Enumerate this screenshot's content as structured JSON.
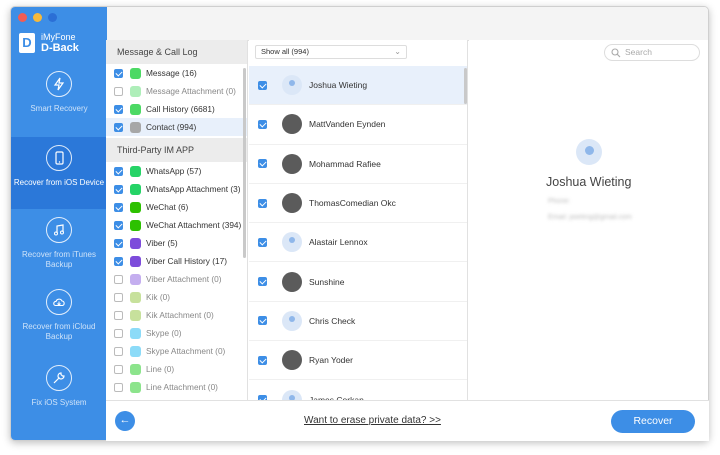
{
  "app": {
    "brand_top": "iMyFone",
    "brand_bottom": "D-Back"
  },
  "nav": [
    {
      "label": "Smart Recovery",
      "icon": "lightning-icon",
      "active": false
    },
    {
      "label": "Recover from iOS Device",
      "icon": "phone-icon",
      "active": true
    },
    {
      "label": "Recover from iTunes Backup",
      "icon": "music-icon",
      "active": false
    },
    {
      "label": "Recover from iCloud Backup",
      "icon": "cloud-icon",
      "active": false
    },
    {
      "label": "Fix iOS System",
      "icon": "wrench-icon",
      "active": false
    }
  ],
  "categories": {
    "group1": "Message & Call Log",
    "group2": "Third-Party IM APP",
    "items1": [
      {
        "label": "Message (16)",
        "checked": true,
        "color": "#4cd964"
      },
      {
        "label": "Message Attachment (0)",
        "checked": false,
        "color": "#4cd964"
      },
      {
        "label": "Call History (6681)",
        "checked": true,
        "color": "#4cd964"
      },
      {
        "label": "Contact (994)",
        "checked": true,
        "color": "#a7a7a7"
      }
    ],
    "items2": [
      {
        "label": "WhatsApp (57)",
        "checked": true,
        "color": "#25d366"
      },
      {
        "label": "WhatsApp Attachment (3)",
        "checked": true,
        "color": "#25d366"
      },
      {
        "label": "WeChat (6)",
        "checked": true,
        "color": "#2dc100"
      },
      {
        "label": "WeChat Attachment (394)",
        "checked": true,
        "color": "#2dc100"
      },
      {
        "label": "Viber (5)",
        "checked": true,
        "color": "#7d4cdb"
      },
      {
        "label": "Viber Call History (17)",
        "checked": true,
        "color": "#7d4cdb"
      },
      {
        "label": "Viber Attachment (0)",
        "checked": false,
        "color": "#7d4cdb"
      },
      {
        "label": "Kik (0)",
        "checked": false,
        "color": "#82bc23"
      },
      {
        "label": "Kik Attachment (0)",
        "checked": false,
        "color": "#82bc23"
      },
      {
        "label": "Skype (0)",
        "checked": false,
        "color": "#00aff0"
      },
      {
        "label": "Skype Attachment (0)",
        "checked": false,
        "color": "#00aff0"
      },
      {
        "label": "Line (0)",
        "checked": false,
        "color": "#00c300"
      },
      {
        "label": "Line Attachment (0)",
        "checked": false,
        "color": "#00c300"
      }
    ]
  },
  "list": {
    "filter": "Show all (994)",
    "search_placeholder": "Search",
    "contacts": [
      {
        "name": "Joshua Wieting",
        "avatar": "default"
      },
      {
        "name": "MattVanden Eynden",
        "avatar": "photo"
      },
      {
        "name": "Mohammad Rafiee",
        "avatar": "photo"
      },
      {
        "name": "ThomasComedian Okc",
        "avatar": "photo"
      },
      {
        "name": "Alastair Lennox",
        "avatar": "default"
      },
      {
        "name": "Sunshine",
        "avatar": "photo"
      },
      {
        "name": "Chris Check",
        "avatar": "default"
      },
      {
        "name": "Ryan Yoder",
        "avatar": "photo"
      },
      {
        "name": "James Corkan",
        "avatar": "default"
      }
    ]
  },
  "detail": {
    "name": "Joshua Wieting",
    "phone_label": "Phone:",
    "email_label": "Email:",
    "email_value": "jwieting@gmail.com"
  },
  "bottom": {
    "erase_link": "Want to erase private data? >>",
    "recover": "Recover",
    "back": "←"
  }
}
